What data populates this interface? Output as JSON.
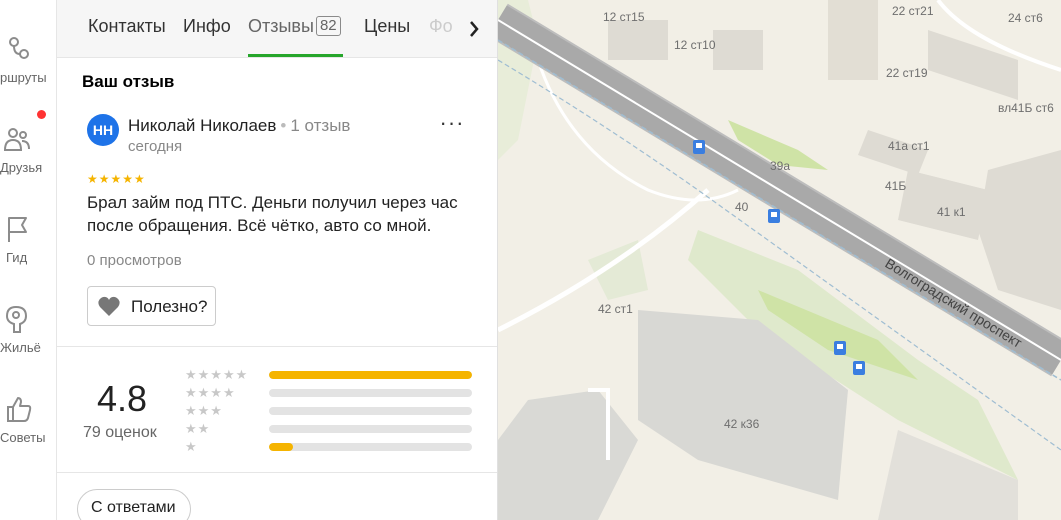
{
  "sidebar": {
    "items": [
      {
        "label": "ршруты",
        "icon": "routes-icon"
      },
      {
        "label": "Друзья",
        "icon": "friends-icon"
      },
      {
        "label": "Гид",
        "icon": "flag-icon"
      },
      {
        "label": "Жильё",
        "icon": "housing-icon"
      },
      {
        "label": "Советы",
        "icon": "thumbs-up-icon"
      }
    ]
  },
  "tabs": {
    "contacts": "Контакты",
    "info": "Инфо",
    "reviews": "Отзывы",
    "reviews_count": "82",
    "prices": "Цены",
    "photos_partial": "Фо"
  },
  "your_review": {
    "title": "Ваш отзыв",
    "avatar_initials": "НН",
    "author": "Николай Николаев",
    "author_reviews": "1 отзыв",
    "date": "сегодня",
    "stars": "★★★★★",
    "text": "Брал займ под ПТС. Деньги получил через час после обращения. Всё чётко, авто со мной.",
    "views": "0 просмотров",
    "useful_label": "Полезно?"
  },
  "rating": {
    "value": "4.8",
    "count_label": "79 оценок",
    "distribution": [
      {
        "stars": "★★★★★",
        "fraction": 1.0
      },
      {
        "stars": "★★★★",
        "fraction": 0.0
      },
      {
        "stars": "★★★",
        "fraction": 0.0
      },
      {
        "stars": "★★",
        "fraction": 0.0
      },
      {
        "stars": "★",
        "fraction": 0.12
      }
    ]
  },
  "filters": {
    "with_answers": "С ответами"
  },
  "map": {
    "labels": [
      "12 ст15",
      "12 ст10",
      "22 ст21",
      "24 ст6",
      "22 ст19",
      "вл41Б ст6",
      "41а ст1",
      "39а",
      "41Б",
      "40",
      "41 к1",
      "Волгоградский проспект",
      "42 ст1",
      "42 к36"
    ]
  },
  "colors": {
    "accent_green": "#26a62b",
    "star_yellow": "#f5b400",
    "avatar_blue": "#1e73e8",
    "notification_red": "#ff3333"
  }
}
